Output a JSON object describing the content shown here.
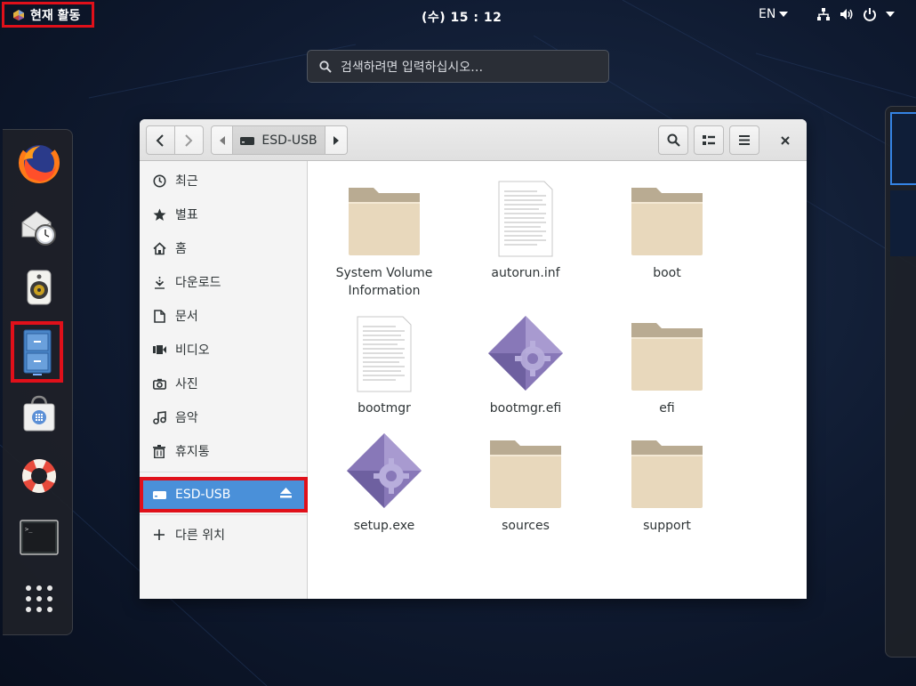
{
  "topbar": {
    "activities_label": "현재 활동",
    "clock": "(수) 15 : 12",
    "language": "EN",
    "icons": [
      "network-icon",
      "volume-icon",
      "power-icon"
    ]
  },
  "search": {
    "placeholder": "검색하려면 입력하십시오…"
  },
  "dash": {
    "apps": [
      "firefox",
      "evolution-mail",
      "rhythmbox",
      "files",
      "software",
      "help",
      "terminal",
      "show-apps"
    ]
  },
  "window": {
    "path_label": "ESD-USB",
    "sidebar": {
      "items": [
        {
          "label": "최근",
          "icon": "clock-icon"
        },
        {
          "label": "별표",
          "icon": "star-icon"
        },
        {
          "label": "홈",
          "icon": "home-icon"
        },
        {
          "label": "다운로드",
          "icon": "download-icon"
        },
        {
          "label": "문서",
          "icon": "document-icon"
        },
        {
          "label": "비디오",
          "icon": "video-icon"
        },
        {
          "label": "사진",
          "icon": "camera-icon"
        },
        {
          "label": "음악",
          "icon": "music-icon"
        },
        {
          "label": "휴지통",
          "icon": "trash-icon"
        }
      ],
      "device": {
        "label": "ESD-USB",
        "icon": "drive-icon"
      },
      "other": {
        "label": "다른 위치",
        "icon": "plus-icon"
      }
    },
    "files": [
      {
        "name": "System Volume Information",
        "type": "folder"
      },
      {
        "name": "autorun.inf",
        "type": "text"
      },
      {
        "name": "boot",
        "type": "folder"
      },
      {
        "name": "bootmgr",
        "type": "text"
      },
      {
        "name": "bootmgr.efi",
        "type": "executable"
      },
      {
        "name": "efi",
        "type": "folder"
      },
      {
        "name": "setup.exe",
        "type": "executable"
      },
      {
        "name": "sources",
        "type": "folder"
      },
      {
        "name": "support",
        "type": "folder"
      }
    ]
  },
  "colors": {
    "highlight_red": "#e0101a",
    "selection_blue": "#4a90d9",
    "folder_tan": "#e8d8bc"
  }
}
